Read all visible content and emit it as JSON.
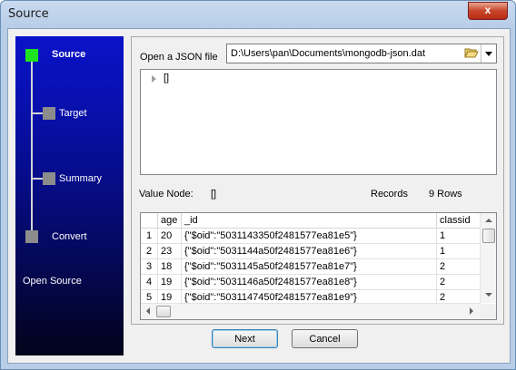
{
  "window": {
    "title": "Source",
    "close_glyph": "x"
  },
  "wizard": {
    "steps": [
      {
        "label": "Source",
        "active": true
      },
      {
        "label": "Target",
        "active": false
      },
      {
        "label": "Summary",
        "active": false
      },
      {
        "label": "Convert",
        "active": false
      }
    ],
    "footer": "Open Source"
  },
  "file": {
    "label": "Open a JSON file",
    "path": "D:\\Users\\pan\\Documents\\mongodb-json.dat",
    "folder_icon": "folder-open-icon"
  },
  "tree": {
    "root": "[]"
  },
  "value_node": {
    "label": "Value Node:",
    "value": "[]"
  },
  "records": {
    "label": "Records",
    "value": "9 Rows"
  },
  "grid": {
    "columns": [
      "age",
      "_id",
      "classid"
    ],
    "rows": [
      {
        "num": "1",
        "age": "20",
        "id": "{\"$oid\":\"5031143350f2481577ea81e5\"}",
        "classid": "1"
      },
      {
        "num": "2",
        "age": "23",
        "id": "{\"$oid\":\"5031144a50f2481577ea81e6\"}",
        "classid": "1"
      },
      {
        "num": "3",
        "age": "18",
        "id": "{\"$oid\":\"5031145a50f2481577ea81e7\"}",
        "classid": "2"
      },
      {
        "num": "4",
        "age": "19",
        "id": "{\"$oid\":\"5031146a50f2481577ea81e8\"}",
        "classid": "2"
      },
      {
        "num": "5",
        "age": "19",
        "id": "{\"$oid\":\"5031147450f2481577ea81e9\"}",
        "classid": "2"
      }
    ]
  },
  "buttons": {
    "next": "Next",
    "cancel": "Cancel"
  },
  "colors": {
    "active_step": "#1ee21e",
    "inactive_step": "#8c8c8c",
    "wizard_top": "#0a12c8",
    "close_button": "#c7452a"
  }
}
